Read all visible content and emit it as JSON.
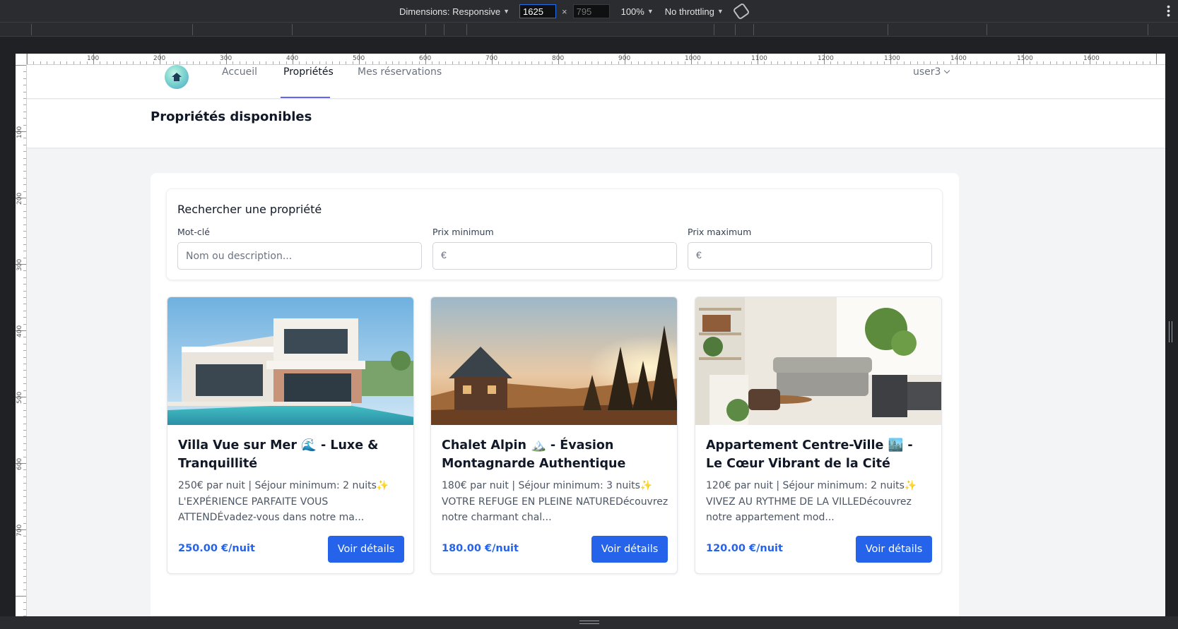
{
  "devtools": {
    "dimensions_label": "Dimensions: Responsive",
    "width_value": "1625",
    "height_placeholder": "795",
    "times": "×",
    "zoom": "100%",
    "throttling": "No throttling",
    "menu_icon": "kebab-icon"
  },
  "ruler": {
    "top_labels": [
      "100",
      "200",
      "300",
      "400",
      "500",
      "600",
      "700",
      "800",
      "900",
      "1000",
      "1100",
      "1200",
      "1300",
      "1400",
      "1500",
      "1600"
    ],
    "left_labels": [
      "100",
      "200",
      "300",
      "400",
      "500",
      "600",
      "700"
    ]
  },
  "nav": {
    "logo": "logo-icon",
    "links": [
      "Accueil",
      "Propriétés",
      "Mes réservations"
    ],
    "active_index": 1,
    "user": "user3"
  },
  "page": {
    "title": "Propriétés disponibles"
  },
  "search": {
    "title": "Rechercher une propriété",
    "keyword_label": "Mot-clé",
    "keyword_placeholder": "Nom ou description...",
    "min_label": "Prix minimum",
    "max_label": "Prix maximum",
    "currency": "€"
  },
  "properties": [
    {
      "title": "Villa Vue sur Mer 🌊 - Luxe & Tranquillité",
      "description": "250€ par nuit | Séjour minimum: 2 nuits✨ L'EXPÉRIENCE PARFAITE VOUS ATTENDÉvadez-vous dans notre ma...",
      "price": "250.00 €/nuit",
      "button": "Voir détails"
    },
    {
      "title": "Chalet Alpin 🏔️ - Évasion Montagnarde Authentique",
      "description": "180€ par nuit | Séjour minimum: 3 nuits✨ VOTRE REFUGE EN PLEINE NATUREDécouvrez notre charmant chal...",
      "price": "180.00 €/nuit",
      "button": "Voir détails"
    },
    {
      "title": "Appartement Centre-Ville 🏙️ - Le Cœur Vibrant de la Cité",
      "description": "120€ par nuit | Séjour minimum: 2 nuits✨ VIVEZ AU RYTHME DE LA VILLEDécouvrez notre appartement mod...",
      "price": "120.00 €/nuit",
      "button": "Voir détails"
    }
  ],
  "colors": {
    "accent": "#2563eb",
    "nav_underline": "#6366f1"
  }
}
